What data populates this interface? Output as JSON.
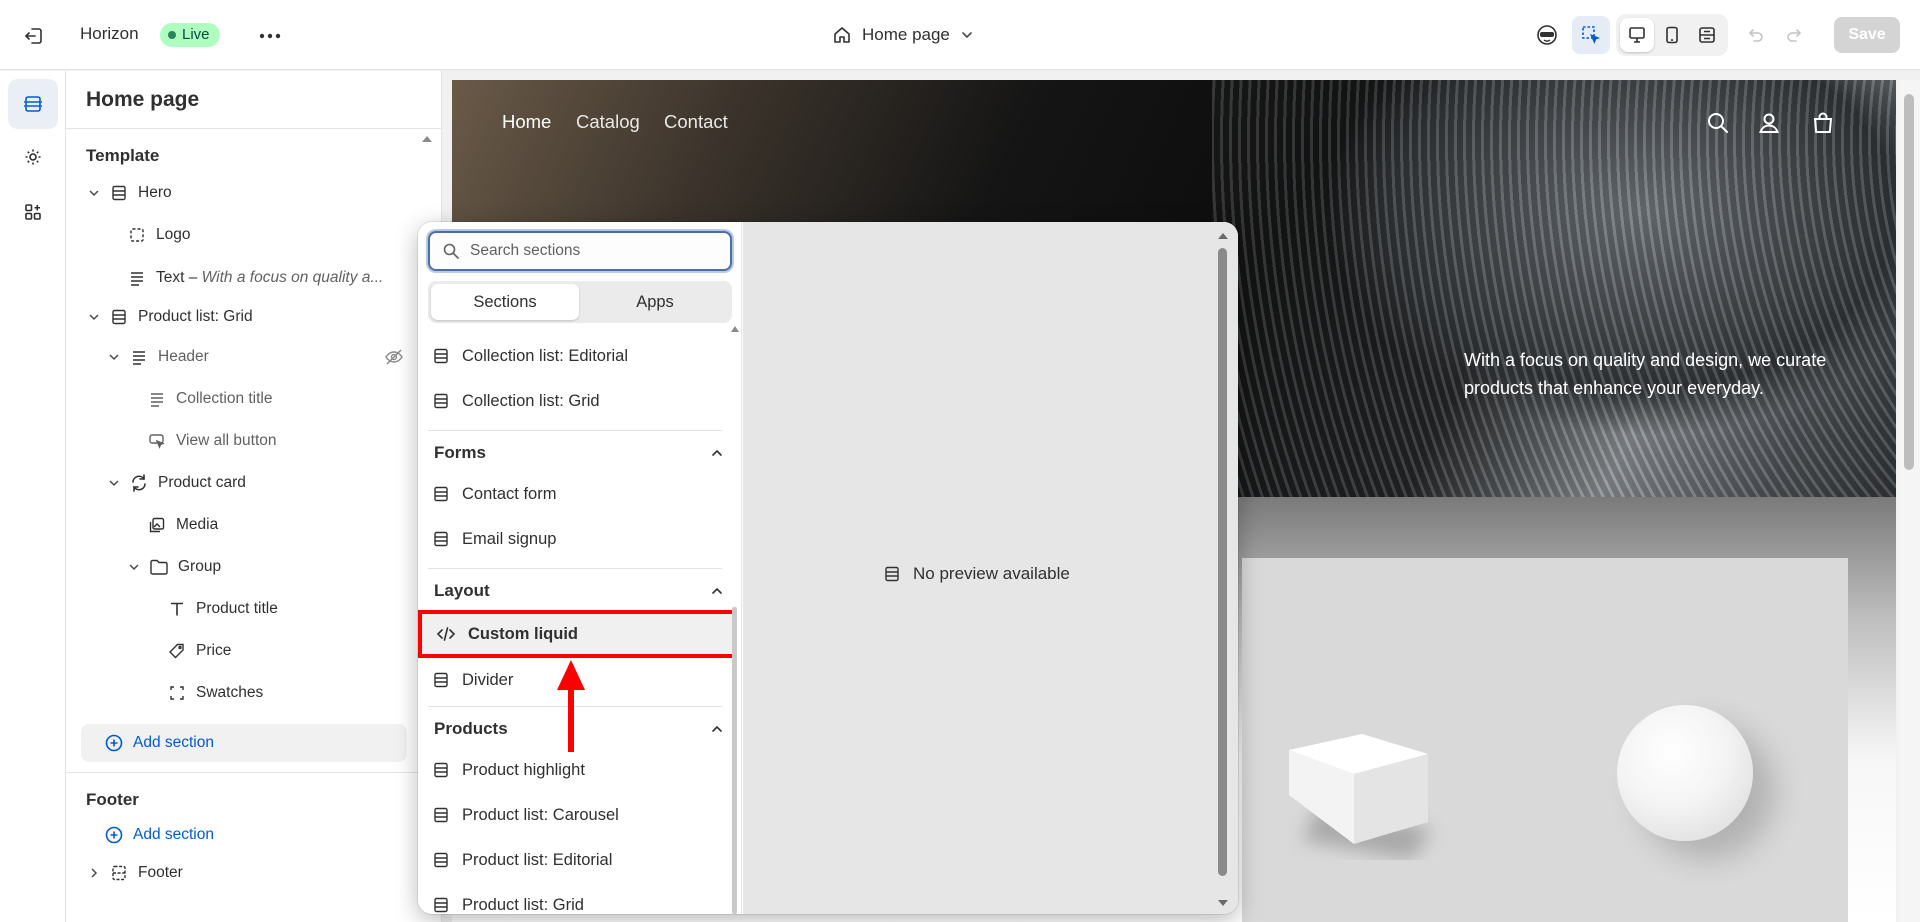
{
  "topbar": {
    "theme_name": "Horizon",
    "live_badge": "Live",
    "page_selector": "Home page",
    "save_label": "Save"
  },
  "sidebar": {
    "title": "Home page",
    "template_heading": "Template",
    "tree": {
      "hero": "Hero",
      "logo": "Logo",
      "text_label": "Text",
      "text_preview": "With a focus on quality a...",
      "product_list_grid": "Product list: Grid",
      "header": "Header",
      "collection_title": "Collection title",
      "view_all_button": "View all button",
      "product_card": "Product card",
      "media": "Media",
      "group": "Group",
      "product_title": "Product title",
      "price": "Price",
      "swatches": "Swatches"
    },
    "add_section": "Add section",
    "footer_heading": "Footer",
    "footer_add_section": "Add section",
    "footer_item": "Footer"
  },
  "preview": {
    "nav": [
      "Home",
      "Catalog",
      "Contact"
    ],
    "hero_text": "With a focus on quality and design, we curate products that enhance your everyday."
  },
  "picker": {
    "search_placeholder": "Search sections",
    "tabs": [
      "Sections",
      "Apps"
    ],
    "items_top": [
      "Collection list: Editorial",
      "Collection list: Grid"
    ],
    "forms_heading": "Forms",
    "forms_items": [
      "Contact form",
      "Email signup"
    ],
    "layout_heading": "Layout",
    "layout_items": [
      "Custom liquid",
      "Divider"
    ],
    "products_heading": "Products",
    "products_items": [
      "Product highlight",
      "Product list: Carousel",
      "Product list: Editorial",
      "Product list: Grid"
    ],
    "no_preview": "No preview available"
  },
  "colors": {
    "accent": "#005bd3",
    "live_bg": "#affebf",
    "annotation": "#ff0000"
  }
}
